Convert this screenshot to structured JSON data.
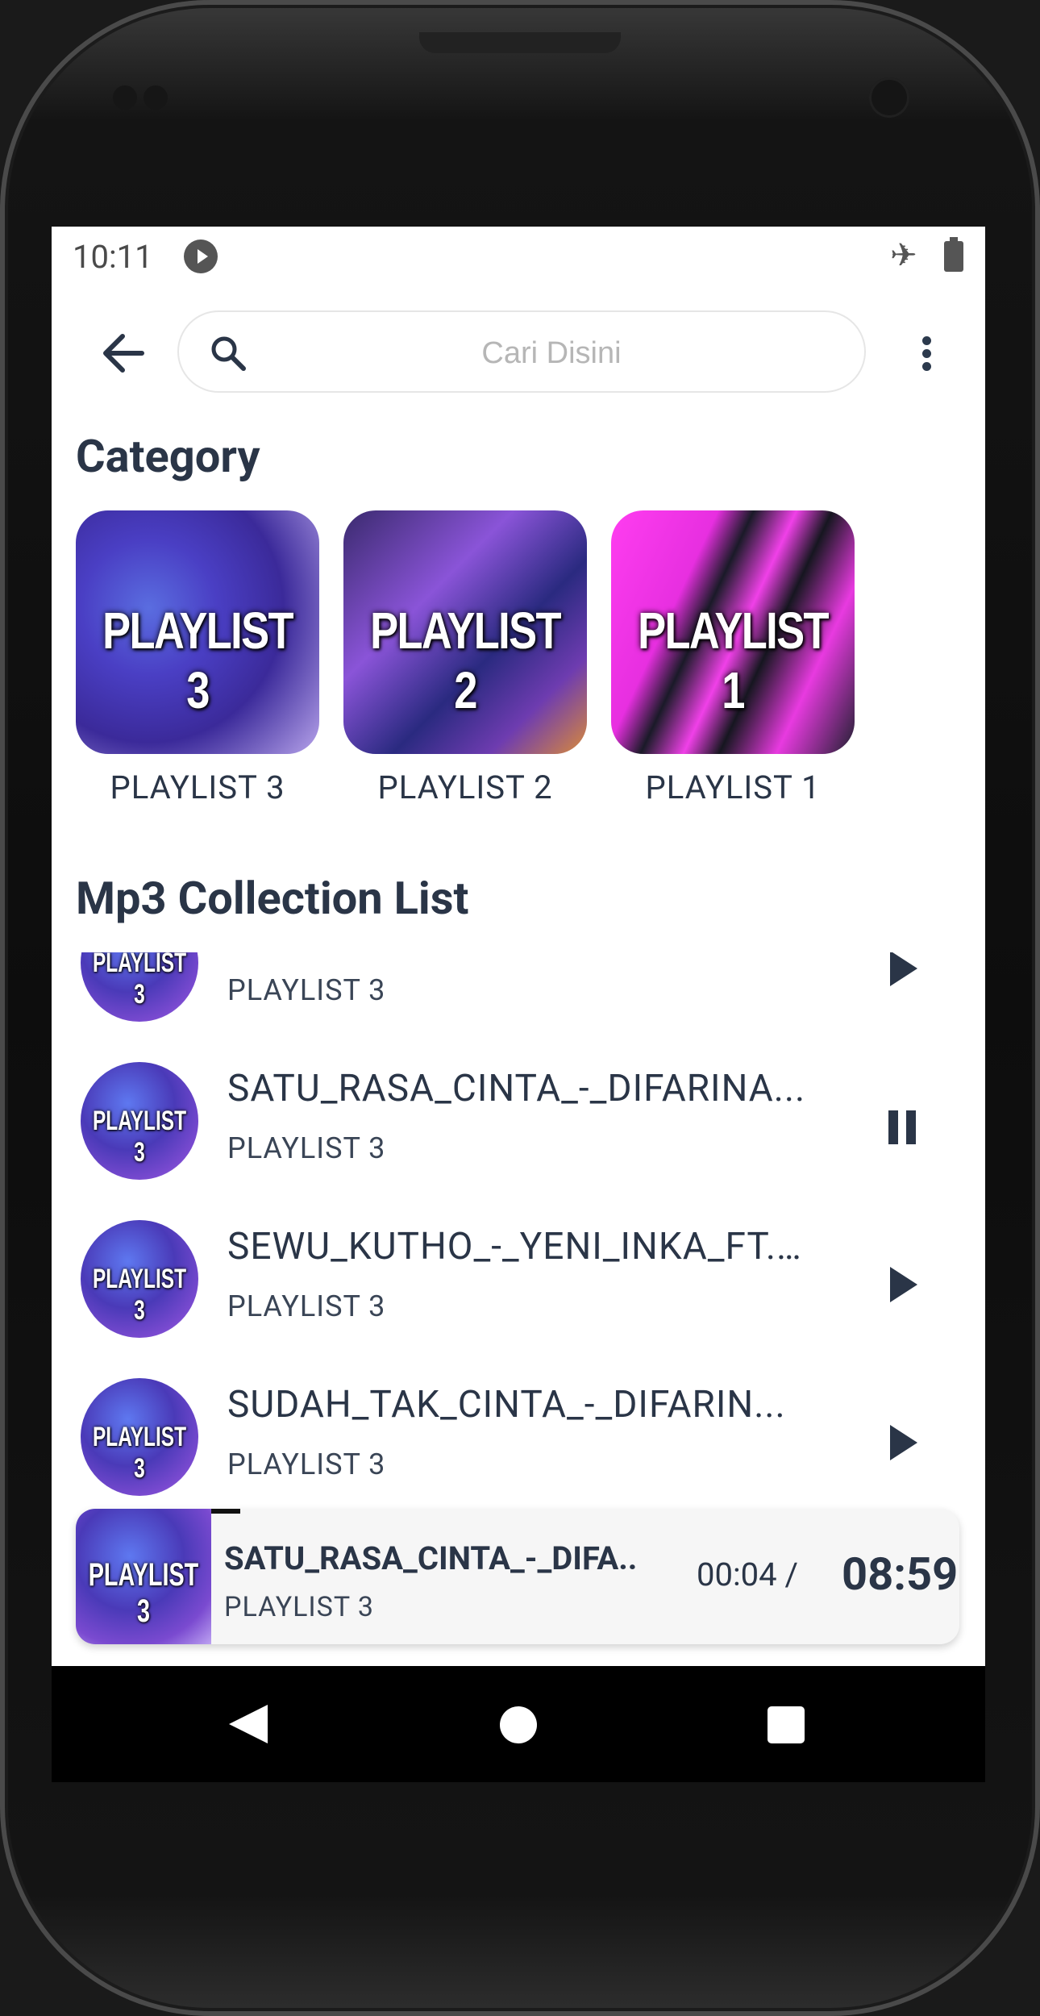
{
  "status_bar": {
    "time": "10:11"
  },
  "search": {
    "placeholder": "Cari Disini",
    "value": ""
  },
  "category": {
    "title": "Category",
    "items": [
      {
        "thumb_text": "PLAYLIST 3",
        "label": "PLAYLIST 3"
      },
      {
        "thumb_text": "PLAYLIST 2",
        "label": "PLAYLIST 2"
      },
      {
        "thumb_text": "PLAYLIST 1",
        "label": "PLAYLIST 1"
      }
    ]
  },
  "collection": {
    "title": "Mp3 Collection List",
    "items": [
      {
        "thumb_text": "PLAYLIST 3",
        "title": "",
        "subtitle": "PLAYLIST 3",
        "state": "play"
      },
      {
        "thumb_text": "PLAYLIST 3",
        "title": "SATU_RASA_CINTA_-_DIFARINA...",
        "subtitle": "PLAYLIST 3",
        "state": "pause"
      },
      {
        "thumb_text": "PLAYLIST 3",
        "title": "SEWU_KUTHO_-_YENI_INKA_FT....",
        "subtitle": "PLAYLIST 3",
        "state": "play"
      },
      {
        "thumb_text": "PLAYLIST 3",
        "title": "SUDAH_TAK_CINTA_-_DIFARIN...",
        "subtitle": "PLAYLIST 3",
        "state": "play"
      }
    ]
  },
  "now_playing": {
    "thumb_text": "PLAYLIST 3",
    "title": "SATU_RASA_CINTA_-_DIFA..",
    "subtitle": "PLAYLIST 3",
    "current_time": "00:04 /",
    "duration": "08:59",
    "progress_fraction": 0.007
  },
  "colors": {
    "text_primary": "#2a3547",
    "background": "#ffffff",
    "nav_bar": "#000000"
  }
}
